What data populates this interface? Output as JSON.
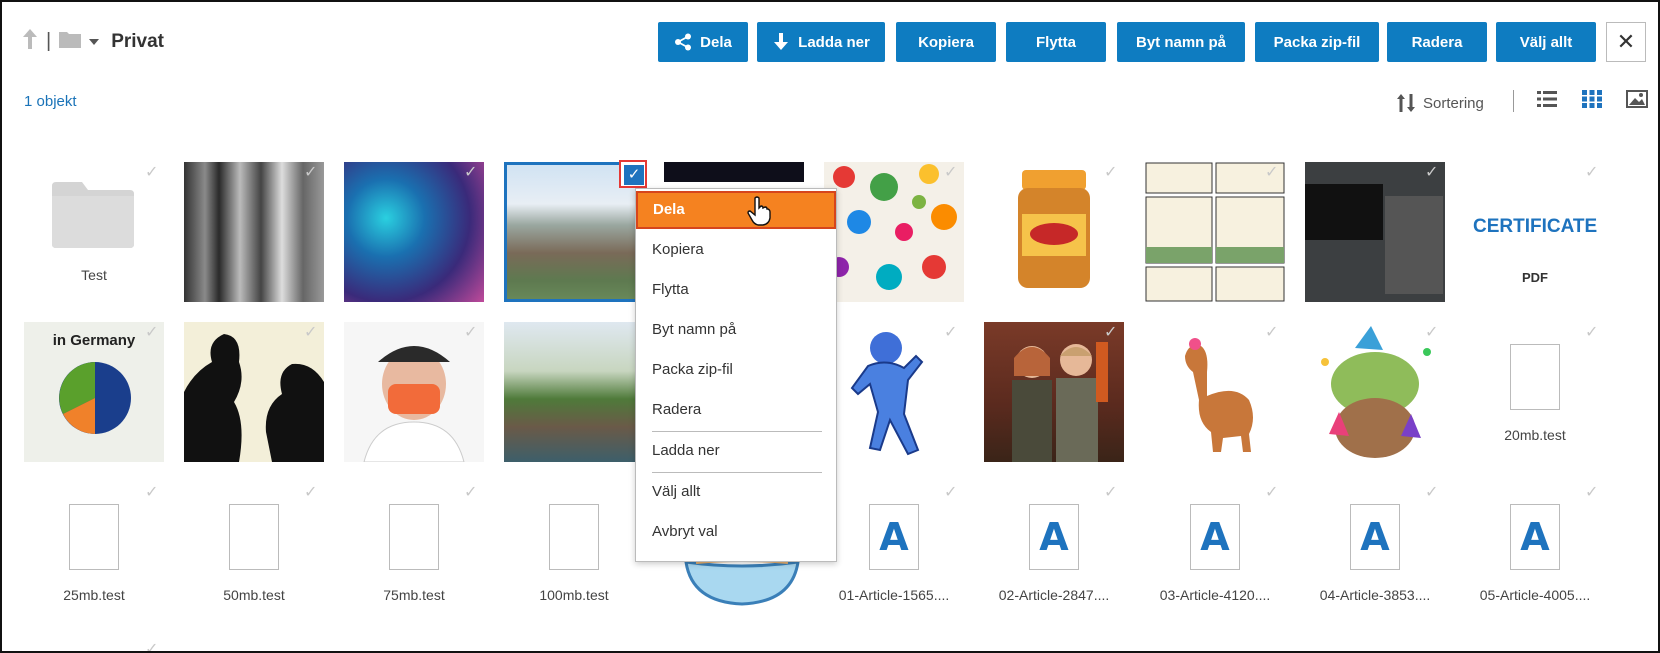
{
  "breadcrumb": {
    "title": "Privat"
  },
  "toolbar": {
    "share": "Dela",
    "download": "Ladda ner",
    "copy": "Kopiera",
    "move": "Flytta",
    "rename": "Byt namn på",
    "zip": "Packa zip-fil",
    "delete": "Radera",
    "select_all": "Välj allt"
  },
  "status": {
    "count": "1 objekt",
    "sort": "Sortering"
  },
  "files": {
    "folder_test": "Test",
    "pdf_label": "PDF",
    "certificate_text": "CERTIFICATE",
    "chart_title": "in Germany",
    "t20": "20mb.test",
    "t25": "25mb.test",
    "t50": "50mb.test",
    "t75": "75mb.test",
    "t100": "100mb.test",
    "a1": "01-Article-1565....",
    "a2": "02-Article-2847....",
    "a3": "03-Article-4120....",
    "a4": "04-Article-3853....",
    "a5": "05-Article-4005....",
    "doc_letter": "A"
  },
  "context_menu": {
    "share": "Dela",
    "copy": "Kopiera",
    "move": "Flytta",
    "rename": "Byt namn på",
    "zip": "Packa zip-fil",
    "delete": "Radera",
    "download": "Ladda ner",
    "select_all": "Välj allt",
    "cancel": "Avbryt val"
  },
  "colors": {
    "accent": "#0e7cc1",
    "menu_active": "#f58220",
    "selection": "#1e73be"
  }
}
